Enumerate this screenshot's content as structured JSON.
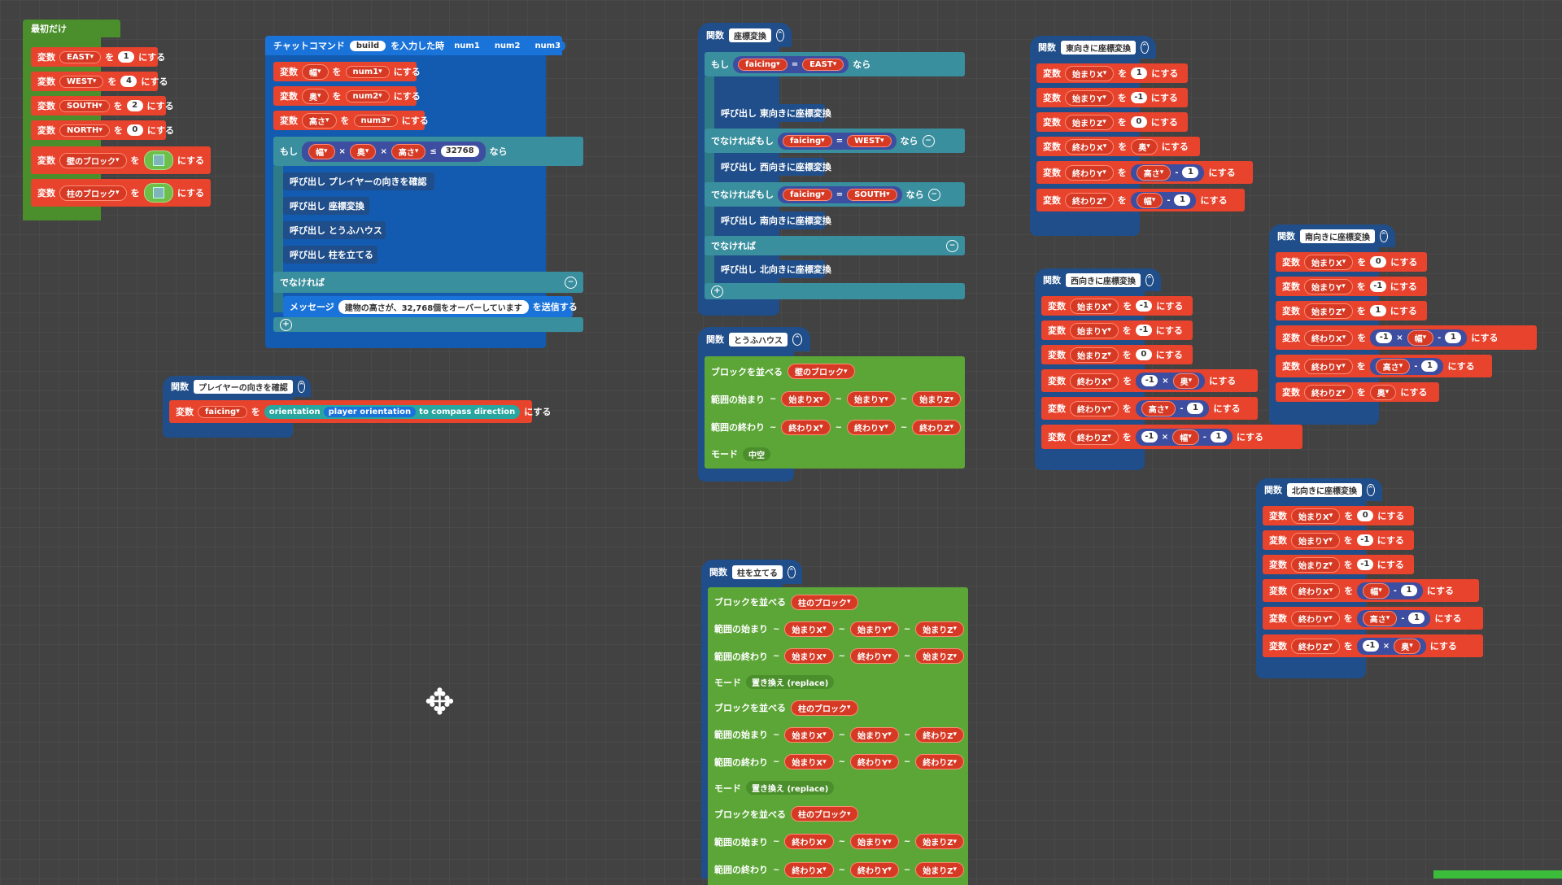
{
  "canvas": {
    "background": "#424242"
  },
  "s_start": {
    "hat": "最初だけ",
    "rows": [
      {
        "kw": "変数",
        "var": "EAST",
        "to": "を",
        "val": "1",
        "end": "にする"
      },
      {
        "kw": "変数",
        "var": "WEST",
        "to": "を",
        "val": "4",
        "end": "にする"
      },
      {
        "kw": "変数",
        "var": "SOUTH",
        "to": "を",
        "val": "2",
        "end": "にする"
      },
      {
        "kw": "変数",
        "var": "NORTH",
        "to": "を",
        "val": "0",
        "end": "にする"
      },
      {
        "kw": "変数",
        "var": "壁のブロック",
        "to": "を",
        "end": "にする"
      },
      {
        "kw": "変数",
        "var": "柱のブロック",
        "to": "を",
        "end": "にする"
      }
    ]
  },
  "s_chat": {
    "hat": {
      "label": "チャットコマンド",
      "cmd": "build",
      "entered": "を入力した時",
      "p1": "num1",
      "p2": "num2",
      "p3": "num3"
    },
    "rows": [
      {
        "kw": "変数",
        "var": "幅",
        "to": "を",
        "val": "num1",
        "end": "にする"
      },
      {
        "kw": "変数",
        "var": "奥",
        "to": "を",
        "val": "num2",
        "end": "にする"
      },
      {
        "kw": "変数",
        "var": "高さ",
        "to": "を",
        "val": "num3",
        "end": "にする"
      }
    ],
    "if": {
      "kw": "もし",
      "a": "幅",
      "x1": "×",
      "b": "奥",
      "x2": "×",
      "c": "高さ",
      "cmp": "≤",
      "limit": "32768",
      "then": "なら"
    },
    "calls": [
      "呼び出し プレイヤーの向きを確認",
      "呼び出し 座標変換",
      "呼び出し とうふハウス",
      "呼び出し 柱を立てる"
    ],
    "else": "でなければ",
    "msg": {
      "kw": "メッセージ",
      "text": "建物の高さが、32,768個をオーバーしています",
      "end": "を送信する"
    }
  },
  "s_player": {
    "hat": {
      "kw": "関数",
      "name": "プレイヤーの向きを確認"
    },
    "row": {
      "kw": "変数",
      "var": "faicing",
      "to": "を",
      "f1": "orientation",
      "f2": "player orientation",
      "f3": "to compass direction",
      "end": "にする"
    }
  },
  "s_coord": {
    "hat": {
      "kw": "関数",
      "name": "座標変換"
    },
    "if1": {
      "kw": "もし",
      "var": "faicing",
      "op": "=",
      "val": "EAST",
      "then": "なら"
    },
    "call1": "呼び出し 東向きに座標変換",
    "elif1": {
      "kw": "でなければもし",
      "var": "faicing",
      "op": "=",
      "val": "WEST",
      "then": "なら"
    },
    "call2": "呼び出し 西向きに座標変換",
    "elif2": {
      "kw": "でなければもし",
      "var": "faicing",
      "op": "=",
      "val": "SOUTH",
      "then": "なら"
    },
    "call3": "呼び出し 南向きに座標変換",
    "else": "でなければ",
    "call4": "呼び出し 北向きに座標変換"
  },
  "s_tofu": {
    "hat": {
      "kw": "関数",
      "name": "とうふハウス"
    },
    "fill": {
      "kw": "ブロックを並べる",
      "block": "壁のブロック"
    },
    "from": {
      "kw": "範囲の始まり",
      "a": "始まりX",
      "b": "始まりY",
      "c": "始まりZ"
    },
    "to": {
      "kw": "範囲の終わり",
      "a": "終わりX",
      "b": "終わりY",
      "c": "終わりZ"
    },
    "mode": {
      "kw": "モード",
      "val": "中空"
    }
  },
  "s_pillar": {
    "hat": {
      "kw": "関数",
      "name": "柱を立てる"
    },
    "groups": [
      {
        "fill": "ブロックを並べる",
        "block": "柱のブロック",
        "from": "範囲の始まり",
        "to": "範囲の終わり",
        "sx": "始まりX",
        "sy": "始まりY",
        "sz": "始まりZ",
        "ex": "始まりX",
        "ey": "終わりY",
        "ez": "始まりZ",
        "mode": "モード",
        "mval": "置き換え (replace)"
      },
      {
        "fill": "ブロックを並べる",
        "block": "柱のブロック",
        "from": "範囲の始まり",
        "to": "範囲の終わり",
        "sx": "始まりX",
        "sy": "始まりY",
        "sz": "終わりZ",
        "ex": "始まりX",
        "ey": "終わりY",
        "ez": "終わりZ",
        "mode": "モード",
        "mval": "置き換え (replace)"
      },
      {
        "fill": "ブロックを並べる",
        "block": "柱のブロック",
        "from": "範囲の始まり",
        "to": "範囲の終わり",
        "sx": "終わりX",
        "sy": "始まりY",
        "sz": "始まりZ",
        "ex": "終わりX",
        "ey": "終わりY",
        "ez": "始まりZ"
      }
    ]
  },
  "s_east": {
    "hat": {
      "kw": "関数",
      "name": "東向きに座標変換"
    },
    "rows": [
      {
        "kw": "変数",
        "var": "始まりX",
        "val": "1"
      },
      {
        "kw": "変数",
        "var": "始まりY",
        "val": "-1"
      },
      {
        "kw": "変数",
        "var": "始まりZ",
        "val": "0"
      },
      {
        "kw": "変数",
        "var": "終わりX",
        "v1": "奥"
      },
      {
        "kw": "変数",
        "var": "終わりY",
        "v1": "高さ",
        "op": "-",
        "n": "1"
      },
      {
        "kw": "変数",
        "var": "終わりZ",
        "v1": "幅",
        "op": "-",
        "n": "1"
      }
    ],
    "to": "を",
    "end": "にする"
  },
  "s_west": {
    "hat": {
      "kw": "関数",
      "name": "西向きに座標変換"
    },
    "rows": [
      {
        "kw": "変数",
        "var": "始まりX",
        "val": "-1"
      },
      {
        "kw": "変数",
        "var": "始まりY",
        "val": "-1"
      },
      {
        "kw": "変数",
        "var": "始まりZ",
        "val": "0"
      },
      {
        "kw": "変数",
        "var": "終わりX",
        "n1": "-1",
        "x": "×",
        "v1": "奥"
      },
      {
        "kw": "変数",
        "var": "終わりY",
        "v1": "高さ",
        "op": "-",
        "n": "1"
      },
      {
        "kw": "変数",
        "var": "終わりZ",
        "n1": "-1",
        "x": "×",
        "v1": "幅",
        "op": "-",
        "n": "1"
      }
    ],
    "to": "を",
    "end": "にする"
  },
  "s_south": {
    "hat": {
      "kw": "関数",
      "name": "南向きに座標変換"
    },
    "rows": [
      {
        "kw": "変数",
        "var": "始まりX",
        "val": "0"
      },
      {
        "kw": "変数",
        "var": "始まりY",
        "val": "-1"
      },
      {
        "kw": "変数",
        "var": "始まりZ",
        "val": "1"
      },
      {
        "kw": "変数",
        "var": "終わりX",
        "n1": "-1",
        "x": "×",
        "v1": "幅",
        "op": "-",
        "n": "1"
      },
      {
        "kw": "変数",
        "var": "終わりY",
        "v1": "高さ",
        "op": "-",
        "n": "1"
      },
      {
        "kw": "変数",
        "var": "終わりZ",
        "v1": "奥"
      }
    ],
    "to": "を",
    "end": "にする"
  },
  "s_north": {
    "hat": {
      "kw": "関数",
      "name": "北向きに座標変換"
    },
    "rows": [
      {
        "kw": "変数",
        "var": "始まりX",
        "val": "0"
      },
      {
        "kw": "変数",
        "var": "始まりY",
        "val": "-1"
      },
      {
        "kw": "変数",
        "var": "始まりZ",
        "val": "-1"
      },
      {
        "kw": "変数",
        "var": "終わりX",
        "v1": "幅",
        "op": "-",
        "n": "1"
      },
      {
        "kw": "変数",
        "var": "終わりY",
        "v1": "高さ",
        "op": "-",
        "n": "1"
      },
      {
        "kw": "変数",
        "var": "終わりZ",
        "n1": "-1",
        "x": "×",
        "v1": "奥"
      }
    ],
    "to": "を",
    "end": "にする"
  }
}
